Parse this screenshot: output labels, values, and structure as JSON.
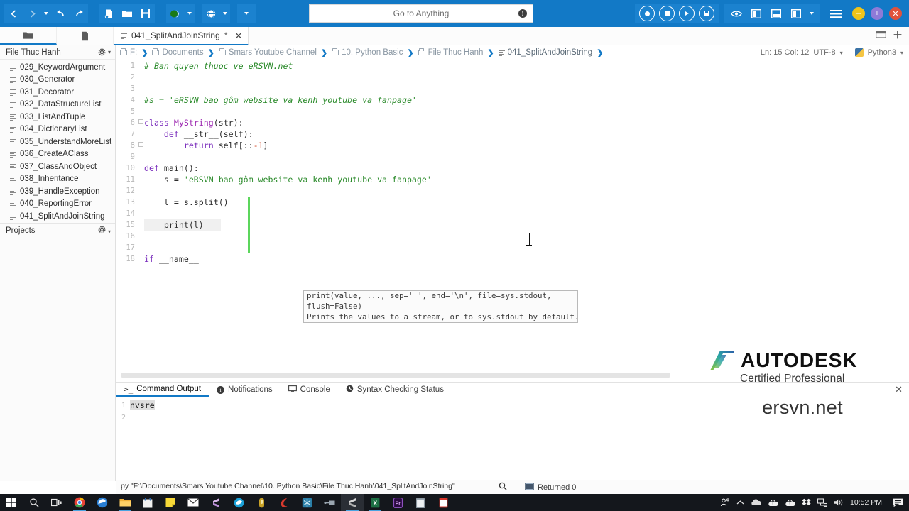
{
  "topbar": {
    "search": {
      "placeholder": "Go to Anything",
      "value": "",
      "info_icon": "!"
    },
    "nav_icons": [
      "back-arrow-icon",
      "forward-arrow-icon",
      "history-dropdown-icon",
      "undo-icon",
      "redo-icon"
    ],
    "file_icons": [
      "new-file-icon",
      "open-folder-icon",
      "save-icon",
      "run-icon",
      "globe-icon",
      "more-icon"
    ],
    "right_icons": [
      "record-icon",
      "stop-icon",
      "play-icon",
      "save-macro-icon",
      "eye-icon",
      "layout-left-icon",
      "layout-bottom-icon",
      "layout-right-icon",
      "layout-dropdown-icon",
      "menu-icon"
    ],
    "window_buttons": [
      "minimize",
      "maximize",
      "close"
    ],
    "accent_color": "#1279c6"
  },
  "tabbar": {
    "left_buttons": [
      "open-folder-icon",
      "file-icon"
    ],
    "document_tab": {
      "label": "041_SplitAndJoinString",
      "dirty_marker": "*",
      "close": "✕"
    },
    "right_icons": [
      "distraction-free-icon",
      "new-tab-icon"
    ]
  },
  "sidebar": {
    "header": {
      "label": "File Thuc Hanh",
      "caret": "▾",
      "gear": "gear-icon"
    },
    "files": [
      "029_KeywordArgument",
      "030_Generator",
      "031_Decorator",
      "032_DataStructureList",
      "033_ListAndTuple",
      "034_DictionaryList",
      "035_UnderstandMoreList",
      "036_CreateAClass",
      "037_ClassAndObject",
      "038_Inheritance",
      "039_HandleException",
      "040_ReportingError",
      "041_SplitAndJoinString"
    ],
    "projects": {
      "label": "Projects",
      "gear": "gear-icon"
    }
  },
  "breadcrumb": {
    "items": [
      {
        "label": "F:",
        "icon": "folder-icon"
      },
      {
        "label": "Documents",
        "icon": "folder-icon"
      },
      {
        "label": "Smars Youtube Channel",
        "icon": "folder-icon"
      },
      {
        "label": "10. Python Basic",
        "icon": "folder-icon"
      },
      {
        "label": "File Thuc Hanh",
        "icon": "folder-icon"
      },
      {
        "label": "041_SplitAndJoinString",
        "icon": "file-lines-icon"
      }
    ],
    "status": {
      "position": "Ln: 15 Col: 12",
      "encoding": "UTF-8",
      "language": "Python3"
    }
  },
  "editor": {
    "line_numbers": [
      1,
      2,
      3,
      4,
      5,
      6,
      7,
      8,
      9,
      10,
      11,
      12,
      13,
      14,
      15,
      16,
      17,
      18
    ],
    "code_lines": [
      {
        "n": 1,
        "tokens": [
          {
            "t": "# Ban quyen thuoc ve eRSVN.net",
            "c": "cmt"
          }
        ]
      },
      {
        "n": 2,
        "tokens": []
      },
      {
        "n": 3,
        "tokens": []
      },
      {
        "n": 4,
        "tokens": [
          {
            "t": "#s = 'eRSVN bao gôm website va kenh youtube va fanpage'",
            "c": "cmt"
          }
        ]
      },
      {
        "n": 5,
        "tokens": []
      },
      {
        "n": 6,
        "tokens": [
          {
            "t": "class ",
            "c": "kw"
          },
          {
            "t": "MyString",
            "c": "cls"
          },
          {
            "t": "(str):",
            "c": "fn"
          }
        ]
      },
      {
        "n": 7,
        "tokens": [
          {
            "t": "    def ",
            "c": "kw"
          },
          {
            "t": "__str__",
            "c": "fn"
          },
          {
            "t": "(self):",
            "c": "fn"
          }
        ]
      },
      {
        "n": 8,
        "tokens": [
          {
            "t": "        return ",
            "c": "kw"
          },
          {
            "t": "self[::",
            "c": "fn"
          },
          {
            "t": "-1",
            "c": "num"
          },
          {
            "t": "]",
            "c": "fn"
          }
        ]
      },
      {
        "n": 9,
        "tokens": []
      },
      {
        "n": 10,
        "tokens": [
          {
            "t": "def ",
            "c": "kw"
          },
          {
            "t": "main",
            "c": "fn"
          },
          {
            "t": "():",
            "c": "fn"
          }
        ]
      },
      {
        "n": 11,
        "tokens": [
          {
            "t": "    s = ",
            "c": "fn"
          },
          {
            "t": "'eRSVN bao gôm website va kenh youtube va fanpage'",
            "c": "str"
          }
        ]
      },
      {
        "n": 12,
        "tokens": []
      },
      {
        "n": 13,
        "tokens": [
          {
            "t": "    l = s.split()",
            "c": "fn"
          }
        ]
      },
      {
        "n": 14,
        "tokens": []
      },
      {
        "n": 15,
        "tokens": [
          {
            "t": "    print(l)",
            "c": "fn"
          }
        ]
      },
      {
        "n": 16,
        "tokens": []
      },
      {
        "n": 17,
        "tokens": []
      },
      {
        "n": 18,
        "tokens": [
          {
            "t": "if ",
            "c": "kw"
          },
          {
            "t": "__name__",
            "c": "fn"
          }
        ]
      }
    ],
    "tooltip": {
      "signature_line1": "print(value, ..., sep=' ', end='\\n', file=sys.stdout,",
      "signature_line2": "flush=False)",
      "description": "Prints the values to a stream, or to sys.stdout by default."
    }
  },
  "watermark": {
    "brand": "AUTODESK",
    "brand_mark": ".",
    "subtitle": "Certified Professional",
    "site": "ersvn.net"
  },
  "panel": {
    "tabs": [
      {
        "label": "Command Output",
        "icon": "terminal-icon",
        "active": true
      },
      {
        "label": "Notifications",
        "icon": "info-icon",
        "active": false
      },
      {
        "label": "Console",
        "icon": "monitor-icon",
        "active": false
      },
      {
        "label": "Syntax Checking Status",
        "icon": "clock-icon",
        "active": false
      }
    ],
    "close": "✕",
    "output_lines": [
      {
        "n": 1,
        "text": "nvsre",
        "selected": true
      },
      {
        "n": 2,
        "text": "",
        "selected": false
      }
    ]
  },
  "statusbar": {
    "command": "py \"F:\\Documents\\Smars Youtube Channel\\10. Python Basic\\File Thuc Hanh\\041_SplitAndJoinString\"",
    "search_icon": "magnifier-icon",
    "terminal_icon": "console-icon",
    "result": "Returned 0"
  },
  "taskbar": {
    "items": [
      "start-icon",
      "search-icon",
      "task-view-icon",
      "chrome-icon",
      "edge-icon",
      "file-explorer-icon",
      "store-icon",
      "sticky-notes-icon",
      "mail-icon",
      "sublime-text-icon",
      "paint3d-icon",
      "unity-icon",
      "camtasia-icon",
      "deepfreeze-icon",
      "putty-icon",
      "sublime-active-icon",
      "excel-icon",
      "premiere-icon",
      "notepad-icon",
      "calendar-icon"
    ],
    "tray": [
      "people-icon",
      "chevron-up-icon",
      "onedrive-icon",
      "onedrive-b-icon",
      "onedrive-c-icon",
      "dropbox-icon",
      "network-icon",
      "volume-icon"
    ],
    "clock": "10:52 PM",
    "action_center": "notification-icon"
  }
}
